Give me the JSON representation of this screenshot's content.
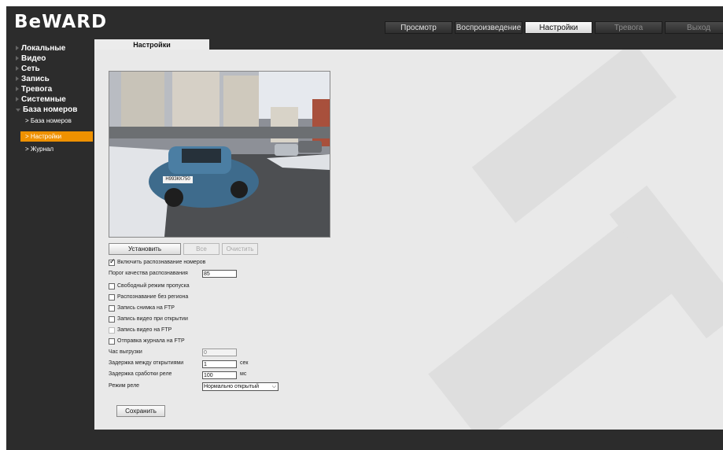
{
  "brand": {
    "logo_text": "BeWARD"
  },
  "top_tabs": [
    {
      "label": "Просмотр",
      "state": "normal"
    },
    {
      "label": "Воспроизведение",
      "state": "normal"
    },
    {
      "label": "Настройки",
      "state": "active"
    },
    {
      "label": "Тревога",
      "state": "dim"
    },
    {
      "label": "Выход",
      "state": "dim"
    }
  ],
  "sidebar": {
    "items": [
      {
        "label": "Локальные"
      },
      {
        "label": "Видео"
      },
      {
        "label": "Сеть"
      },
      {
        "label": "Запись"
      },
      {
        "label": "Тревога"
      },
      {
        "label": "Системные"
      },
      {
        "label": "База номеров"
      }
    ],
    "subitems": [
      {
        "label": "База номеров",
        "active": false
      },
      {
        "label": "Настройки",
        "active": true
      },
      {
        "label": "Журнал",
        "active": false
      }
    ]
  },
  "content": {
    "tab_label": "Настройки",
    "plate_text": "Н993КК750",
    "buttons": {
      "set_label": "Установить",
      "all_label": "Все",
      "clear_label": "Очистить",
      "save_label": "Сохранить"
    },
    "checks": {
      "enable_recognition": {
        "label": "Включить распознавание номеров",
        "checked": true
      },
      "free_mode": {
        "label": "Свободный режим пропуска",
        "checked": false
      },
      "no_region": {
        "label": "Распознавание без региона",
        "checked": false
      },
      "snapshot_ftp": {
        "label": "Запись снимка на FTP",
        "checked": false
      },
      "video_on_open": {
        "label": "Запись видео при открытии",
        "checked": false
      },
      "video_ftp": {
        "label": "Запись видео на FTP",
        "checked": false,
        "disabled": true
      },
      "log_ftp": {
        "label": "Отправка журнала на FTP",
        "checked": false
      }
    },
    "fields": {
      "quality_threshold": {
        "label": "Порог качества распознавания",
        "value": "85"
      },
      "upload_hour": {
        "label": "Час выгрузки",
        "value": "0"
      },
      "open_delay": {
        "label": "Задержка между открытиями",
        "value": "1",
        "unit": "сек"
      },
      "relay_delay": {
        "label": "Задержка сработки реле",
        "value": "100",
        "unit": "мс"
      },
      "relay_mode": {
        "label": "Режим реле",
        "value": "Нормально открытый"
      }
    }
  }
}
